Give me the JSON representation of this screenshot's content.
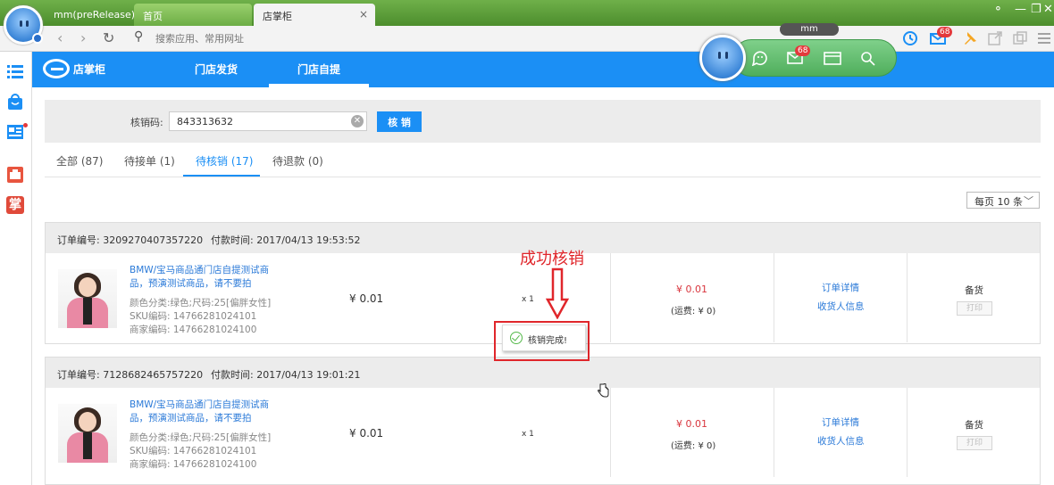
{
  "browser": {
    "tabs": [
      {
        "label": "mm(preRelease)"
      },
      {
        "label": "首页"
      },
      {
        "label": "店掌柜",
        "close": "×"
      }
    ],
    "address_placeholder": "搜索应用、常用网址",
    "float_label": "mm",
    "badge_count": "68",
    "float_badge": "68"
  },
  "app": {
    "logo_text": "店掌柜",
    "nav": [
      {
        "label": "门店发货"
      },
      {
        "label": "门店自提"
      }
    ]
  },
  "verify": {
    "label": "核销码:",
    "value": "843313632",
    "button": "核 销"
  },
  "filter_tabs": [
    {
      "label": "全部 (87)"
    },
    {
      "label": "待接单 (1)"
    },
    {
      "label": "待核销 (17)"
    },
    {
      "label": "待退款 (0)"
    }
  ],
  "per_page": {
    "label": "每页 10 条",
    "chevron": "﹀"
  },
  "orders": [
    {
      "order_no": "订单编号: 3209270407357220",
      "pay_time": "付款时间: 2017/04/13 19:53:52",
      "title": "BMW/宝马商品通门店自提测试商品，预演测试商品，请不要拍",
      "sku_attr": "颜色分类:绿色;尺码:25[偏胖女性]",
      "sku_code": "SKU编码: 14766281024101",
      "merchant_code": "商家编码: 14766281024100",
      "price": "¥ 0.01",
      "qty": "x 1",
      "total": "¥ 0.01",
      "shipping": "(运费: ¥ 0)",
      "detail_link": "订单详情",
      "receiver_link": "收货人信息",
      "status": "备货",
      "print": "打印"
    },
    {
      "order_no": "订单编号: 7128682465757220",
      "pay_time": "付款时间: 2017/04/13 19:01:21",
      "title": "BMW/宝马商品通门店自提测试商品，预演测试商品，请不要拍",
      "sku_attr": "颜色分类:绿色;尺码:25[偏胖女性]",
      "sku_code": "SKU编码: 14766281024101",
      "merchant_code": "商家编码: 14766281024100",
      "price": "¥ 0.01",
      "qty": "x 1",
      "total": "¥ 0.01",
      "shipping": "(运费: ¥ 0)",
      "detail_link": "订单详情",
      "receiver_link": "收货人信息",
      "status": "备货",
      "print": "打印"
    }
  ],
  "annotation": {
    "text": "成功核销"
  },
  "toast": {
    "text": "核销完成!"
  },
  "colors": {
    "brand": "#1b8ff5",
    "chrome_green": "#4c8d2c",
    "alert_red": "#e0262b",
    "success_green": "#55b94b"
  }
}
